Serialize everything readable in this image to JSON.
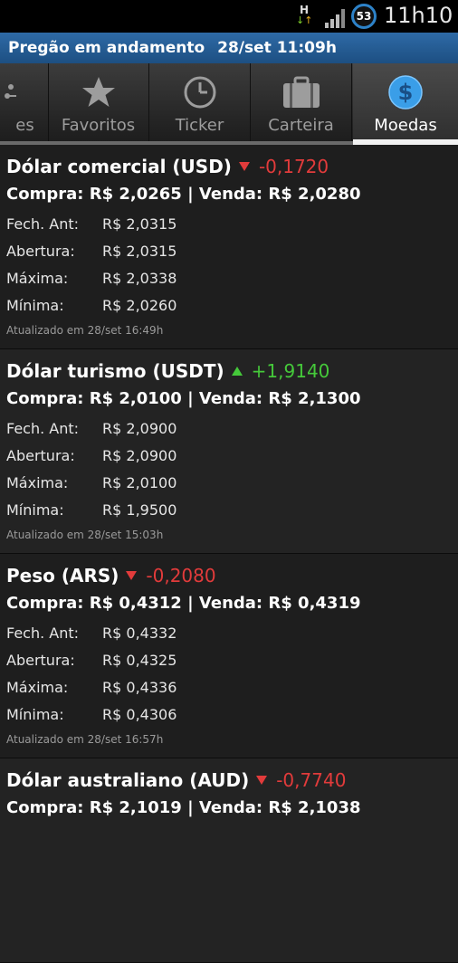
{
  "status_bar": {
    "h_indicator": "H",
    "battery": "53",
    "time": "11h10"
  },
  "banner": {
    "status": "Pregão em andamento",
    "datetime": "28/set 11:09h"
  },
  "tabs": [
    {
      "label": "es",
      "icon": "scatter-icon",
      "active": false
    },
    {
      "label": "Favoritos",
      "icon": "star-icon",
      "active": false
    },
    {
      "label": "Ticker",
      "icon": "clock-icon",
      "active": false
    },
    {
      "label": "Carteira",
      "icon": "briefcase-icon",
      "active": false
    },
    {
      "label": "Moedas",
      "icon": "dollar-coin-icon",
      "active": true
    }
  ],
  "currencies": [
    {
      "title": "Dólar comercial (USD)",
      "direction": "down",
      "change": "-0,1720",
      "quote": "Compra: R$ 2,0265 | Venda: R$ 2,0280",
      "rows": [
        {
          "label": "Fech. Ant:",
          "value": "R$ 2,0315"
        },
        {
          "label": "Abertura:",
          "value": "R$ 2,0315"
        },
        {
          "label": "Máxima:",
          "value": "R$ 2,0338"
        },
        {
          "label": "Mínima:",
          "value": "R$ 2,0260"
        }
      ],
      "updated": "Atualizado em 28/set 16:49h"
    },
    {
      "title": "Dólar turismo (USDT)",
      "direction": "up",
      "change": "+1,9140",
      "quote": "Compra: R$ 2,0100 | Venda: R$ 2,1300",
      "rows": [
        {
          "label": "Fech. Ant:",
          "value": "R$ 2,0900"
        },
        {
          "label": "Abertura:",
          "value": "R$ 2,0900"
        },
        {
          "label": "Máxima:",
          "value": "R$ 2,0100"
        },
        {
          "label": "Mínima:",
          "value": "R$ 1,9500"
        }
      ],
      "updated": "Atualizado em 28/set 15:03h"
    },
    {
      "title": "Peso (ARS)",
      "direction": "down",
      "change": "-0,2080",
      "quote": "Compra: R$ 0,4312 | Venda: R$ 0,4319",
      "rows": [
        {
          "label": "Fech. Ant:",
          "value": "R$ 0,4332"
        },
        {
          "label": "Abertura:",
          "value": "R$ 0,4325"
        },
        {
          "label": "Máxima:",
          "value": "R$ 0,4336"
        },
        {
          "label": "Mínima:",
          "value": "R$ 0,4306"
        }
      ],
      "updated": "Atualizado em 28/set 16:57h"
    },
    {
      "title": "Dólar australiano (AUD)",
      "direction": "down",
      "change": "-0,7740",
      "quote": "Compra: R$ 2,1019 | Venda: R$ 2,1038",
      "rows": [],
      "updated": ""
    }
  ],
  "colors": {
    "banner": "#2e6aa6",
    "negative": "#e23b3b",
    "positive": "#45c93a",
    "accent": "#2d82c8"
  }
}
